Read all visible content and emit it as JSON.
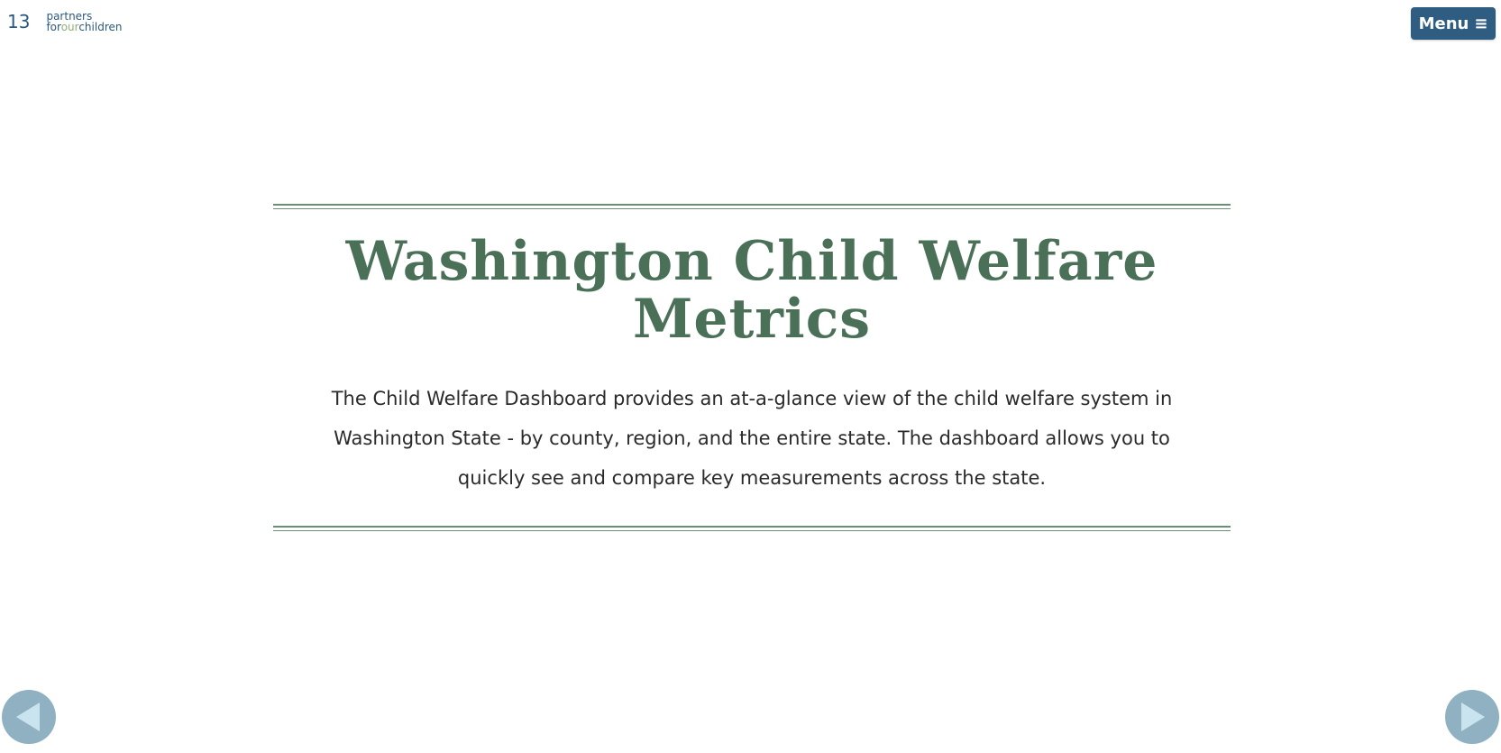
{
  "header": {
    "logo_number": "13",
    "logo_line1": "partners",
    "logo_line2_for": "for",
    "logo_line2_our": "our",
    "logo_line2_children": "children",
    "menu_label": "Menu",
    "menu_icon": "≡"
  },
  "main": {
    "title": "Washington Child Welfare Metrics",
    "description": "The Child Welfare Dashboard provides an at-a-glance view of the child welfare system in Washington State - by county, region, and the entire state. The dashboard allows you to quickly see and compare key measurements across the state."
  },
  "nav": {
    "prev_icon": "triangle-left-icon",
    "next_icon": "triangle-right-icon"
  },
  "colors": {
    "brand_blue": "#2f5d82",
    "title_green": "#4a7058",
    "arrow_bg": "#8fb1c2",
    "arrow_fg": "#c9e4ee"
  }
}
